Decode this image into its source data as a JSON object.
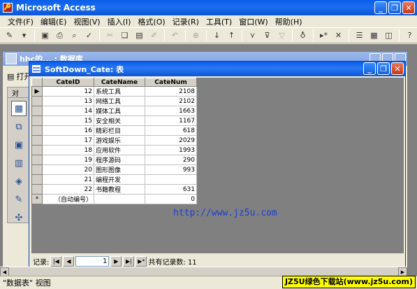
{
  "app": {
    "title": "Microsoft Access",
    "icon": "access-key-icon"
  },
  "menu": [
    "文件(F)",
    "编辑(E)",
    "视图(V)",
    "插入(I)",
    "格式(O)",
    "记录(R)",
    "工具(T)",
    "窗口(W)",
    "帮助(H)"
  ],
  "toolbar": {
    "icons": [
      "design-view-icon",
      "dropdown-icon",
      "save-icon",
      "print-icon",
      "print-preview-icon",
      "spelling-icon",
      "cut-icon",
      "copy-icon",
      "paste-icon",
      "format-painter-icon",
      "undo-icon",
      "hyperlink-icon",
      "sort-asc-icon",
      "sort-desc-icon",
      "filter-selection-icon",
      "filter-form-icon",
      "apply-filter-icon",
      "find-icon",
      "new-record-icon",
      "delete-record-icon",
      "properties-icon",
      "database-window-icon",
      "new-object-icon",
      "help-icon"
    ]
  },
  "db_window": {
    "title": "hhc的... : 数据库",
    "open_label": "打开",
    "tab_label": "对"
  },
  "table_window": {
    "title": "SoftDown_Cate: 表",
    "columns": [
      "CateID",
      "CateName",
      "CateNum"
    ],
    "rows": [
      {
        "id": "12",
        "name": "系统工具",
        "num": "2108"
      },
      {
        "id": "13",
        "name": "网络工具",
        "num": "2102"
      },
      {
        "id": "14",
        "name": "媒体工具",
        "num": "1663"
      },
      {
        "id": "15",
        "name": "安全相关",
        "num": "1167"
      },
      {
        "id": "16",
        "name": "精彩栏目",
        "num": "618"
      },
      {
        "id": "17",
        "name": "游戏娱乐",
        "num": "2029"
      },
      {
        "id": "18",
        "name": "应用软件",
        "num": "1993"
      },
      {
        "id": "19",
        "name": "程序源码",
        "num": "290"
      },
      {
        "id": "20",
        "name": "图形图像",
        "num": "993"
      },
      {
        "id": "21",
        "name": "编程开发",
        "num": ""
      },
      {
        "id": "22",
        "name": "书籍教程",
        "num": "631"
      }
    ],
    "new_row": {
      "marker": "*",
      "id": "（自动编号）",
      "num": "0"
    },
    "current_marker": "▶"
  },
  "recnav": {
    "label": "记录:",
    "current": "1",
    "total_label": "共有记录数: 11"
  },
  "status": {
    "text": "\"数据表\" 视图"
  },
  "watermarks": {
    "url": "http://www.jz5u.com",
    "badge": "JZ5U绿色下载站(www.jz5u.com)"
  }
}
